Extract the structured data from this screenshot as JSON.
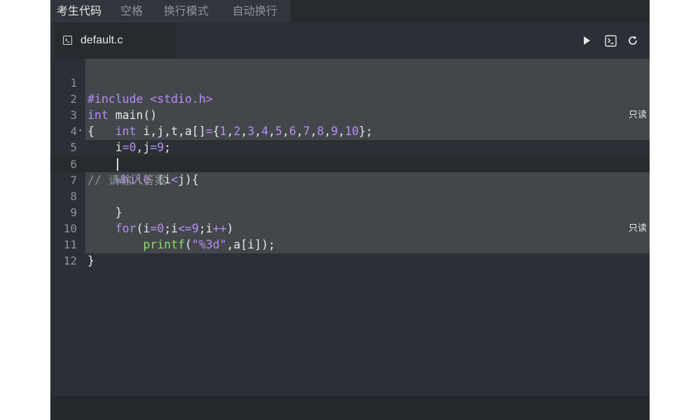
{
  "top_tabs": [
    {
      "label": "考生代码",
      "active": true
    },
    {
      "label": "空格",
      "active": false
    },
    {
      "label": "换行模式",
      "active": false
    },
    {
      "label": "自动换行",
      "active": false
    }
  ],
  "file_tab": {
    "name": "default.c",
    "icon": "terminal-icon"
  },
  "toolbar": {
    "icons": [
      "run-icon",
      "terminal-icon",
      "reset-icon"
    ]
  },
  "readonly_label": "只读",
  "editor": {
    "lines": [
      {
        "no": "1",
        "text": "#include <stdio.h>"
      },
      {
        "no": "2",
        "text": "int main()"
      },
      {
        "no": "3",
        "text": "{   int i,j,t,a[]={1,2,3,4,5,6,7,8,9,10};"
      },
      {
        "no": "4",
        "text": "    i=0,j=9;"
      },
      {
        "no": "5",
        "text": "    while (i<j){"
      },
      {
        "no": "6",
        "text": "// 请输入答案"
      },
      {
        "no": "7",
        "text": ""
      },
      {
        "no": "8",
        "text": "    }"
      },
      {
        "no": "9",
        "text": "    for(i=0;i<=9;i++)"
      },
      {
        "no": "10",
        "text": "        printf(\"%3d\",a[i]);"
      },
      {
        "no": "11",
        "text": "}"
      },
      {
        "no": "12",
        "text": ""
      }
    ]
  },
  "colors": {
    "background": "#2b3036",
    "readonly_bg": "#43474b",
    "keyword": "#b78cf6",
    "function": "#8fdc6b",
    "comment": "#8d9399"
  }
}
